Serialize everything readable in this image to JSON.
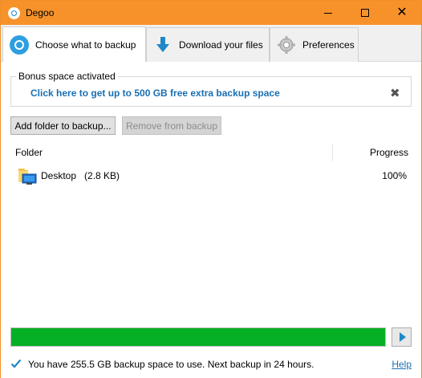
{
  "window": {
    "title": "Degoo",
    "icon": "degoo-logo-icon",
    "controls": {
      "minimize": "minimize-icon",
      "maximize": "maximize-icon",
      "close": "✕"
    }
  },
  "tabs": [
    {
      "label": "Choose what to backup",
      "icon": "backup-icon",
      "active": true
    },
    {
      "label": "Download your files",
      "icon": "download-arrow-icon",
      "active": false
    },
    {
      "label": "Preferences",
      "icon": "gear-icon",
      "active": false
    }
  ],
  "bonus": {
    "legend": "Bonus space activated",
    "link": "Click here to get up to 500 GB free extra backup space",
    "close": "✖"
  },
  "buttons": {
    "add": "Add folder to backup...",
    "remove": "Remove from backup"
  },
  "list": {
    "headers": {
      "folder": "Folder",
      "progress": "Progress"
    },
    "rows": [
      {
        "name": "Desktop   (2.8 KB)",
        "progress": "100%",
        "icon": "desktop-folder-icon"
      }
    ]
  },
  "overall_progress": {
    "fraction": 1.0,
    "color": "#06b025"
  },
  "status": {
    "text": "You have 255.5 GB backup space to use. Next backup in 24 hours.",
    "help": "Help"
  },
  "colors": {
    "titlebar": "#f7922b",
    "accent": "#1a6fb3",
    "progress": "#06b025"
  }
}
